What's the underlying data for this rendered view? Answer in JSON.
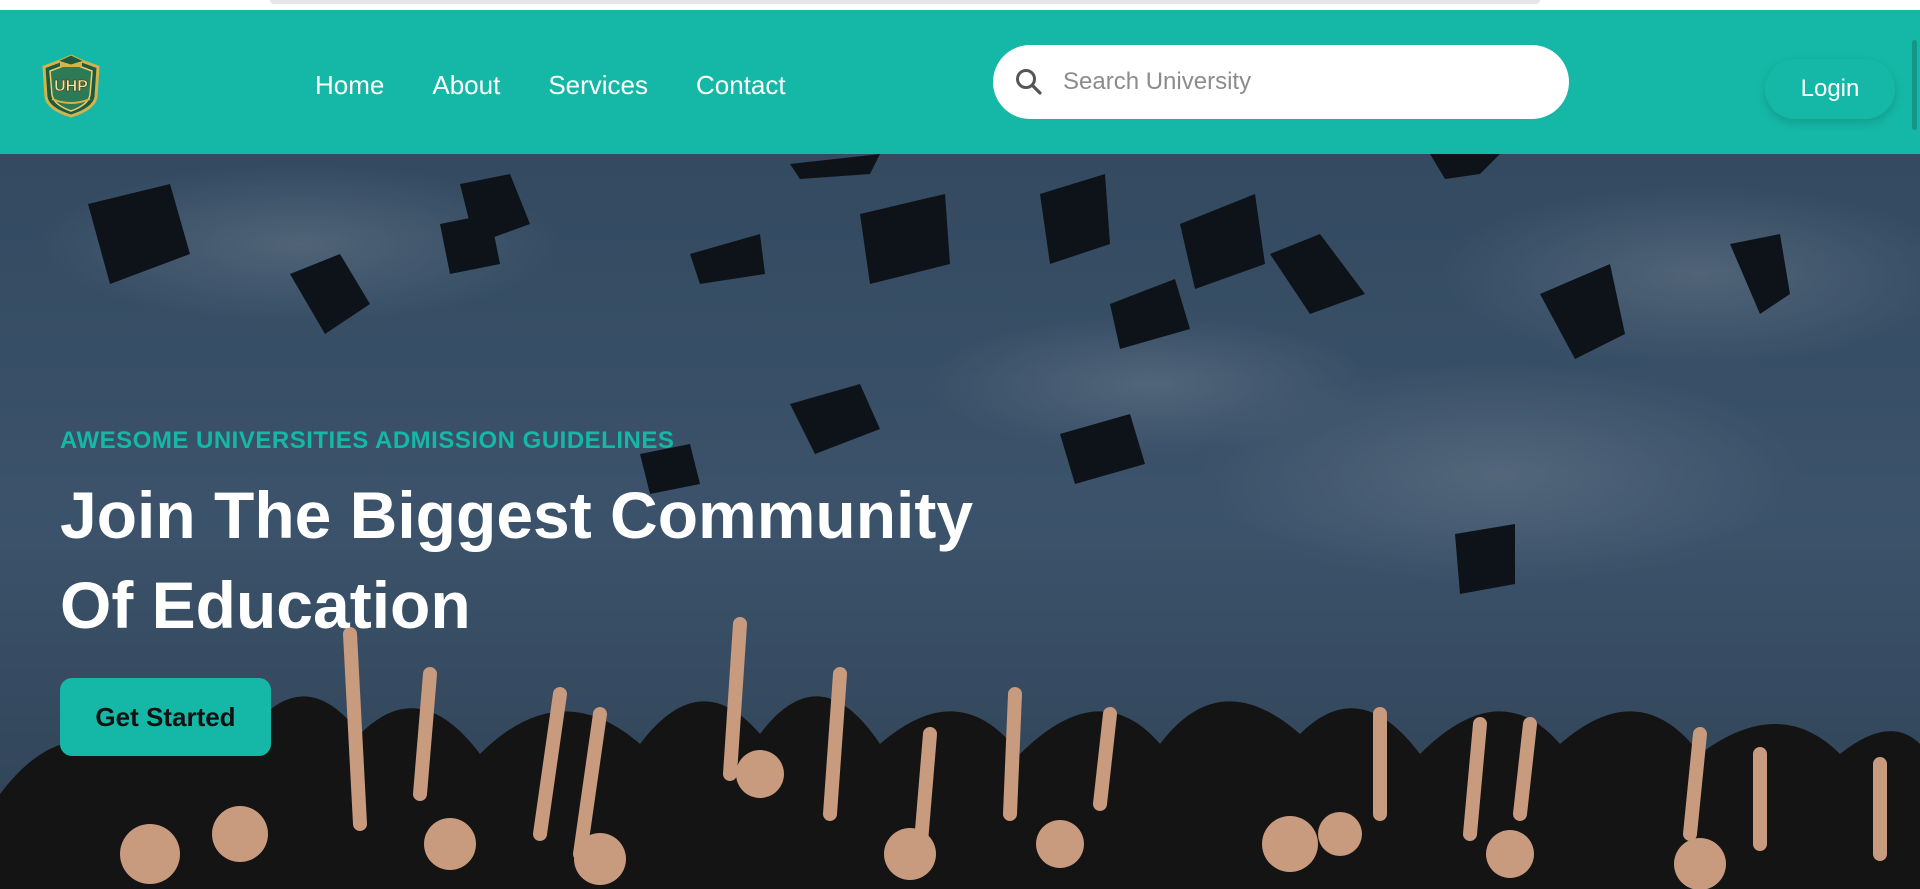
{
  "navbar": {
    "logo_text": "UHP",
    "links": [
      {
        "label": "Home"
      },
      {
        "label": "About"
      },
      {
        "label": "Services"
      },
      {
        "label": "Contact"
      }
    ],
    "search": {
      "placeholder": "Search University",
      "value": ""
    },
    "login_label": "Login",
    "bg_color": "#15b8a6"
  },
  "hero": {
    "eyebrow": "AWESOME UNIVERSITIES ADMISSION GUIDELINES",
    "title_line1": "Join The Biggest Community",
    "title_line2": "Of Education",
    "cta_label": "Get Started",
    "accent_color": "#15b8a6"
  },
  "icons": {
    "search": "search-icon",
    "logo": "university-crest-logo"
  }
}
